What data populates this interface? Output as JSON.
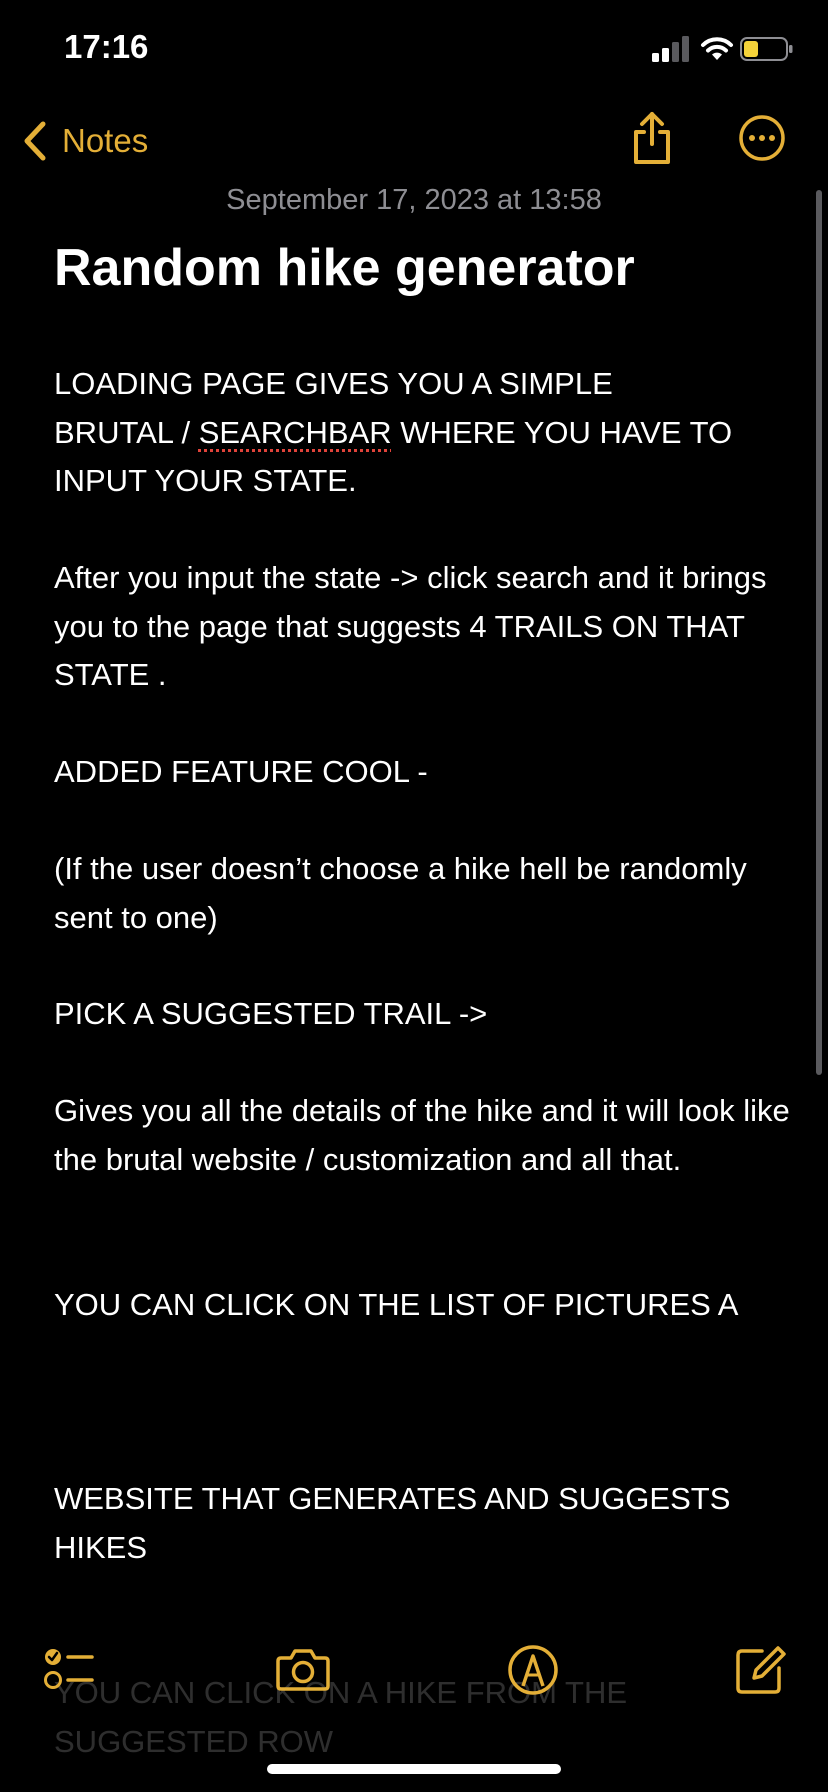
{
  "status_bar": {
    "time": "17:16",
    "signal_icon": "cellular-signal-icon",
    "wifi_icon": "wifi-icon",
    "battery_icon": "battery-icon",
    "battery_level": 0.35,
    "battery_color": "#F5D33A"
  },
  "nav": {
    "back_label": "Notes",
    "back_icon": "chevron-left-icon",
    "share_icon": "share-icon",
    "more_icon": "ellipsis-circle-icon",
    "accent_color": "#E4AF37"
  },
  "note": {
    "date": "September 17, 2023 at 13:58",
    "title": "Random hike generator",
    "p1_line1": "LOADING PAGE GIVES YOU A SIMPLE",
    "p1_line2_before": "BRUTAL / ",
    "p1_line2_flagged": "SEARCHBAR",
    "p1_line2_after": " WHERE YOU HAVE TO",
    "p1_line3": "INPUT YOUR STATE.",
    "p2": "After you input the state -> click search and it brings you to the page that suggests 4 TRAILS ON THAT STATE .",
    "p3": "ADDED FEATURE COOL -",
    "p4": "(If the user doesn’t choose a hike hell be randomly sent to one)",
    "p5": "PICK A SUGGESTED TRAIL ->",
    "p6": "Gives you all the details of the hike and it will look like the brutal website / customization and all that.",
    "p7": "YOU CAN CLICK ON THE LIST OF PICTURES A",
    "p8": "WEBSITE THAT GENERATES AND SUGGESTS HIKES",
    "p9_faded": "YOU CAN CLICK ON A HIKE FROM THE SUGGESTED ROW"
  },
  "toolbar": {
    "checklist_icon": "checklist-icon",
    "camera_icon": "camera-icon",
    "markup_icon": "markup-pen-icon",
    "compose_icon": "compose-icon"
  }
}
